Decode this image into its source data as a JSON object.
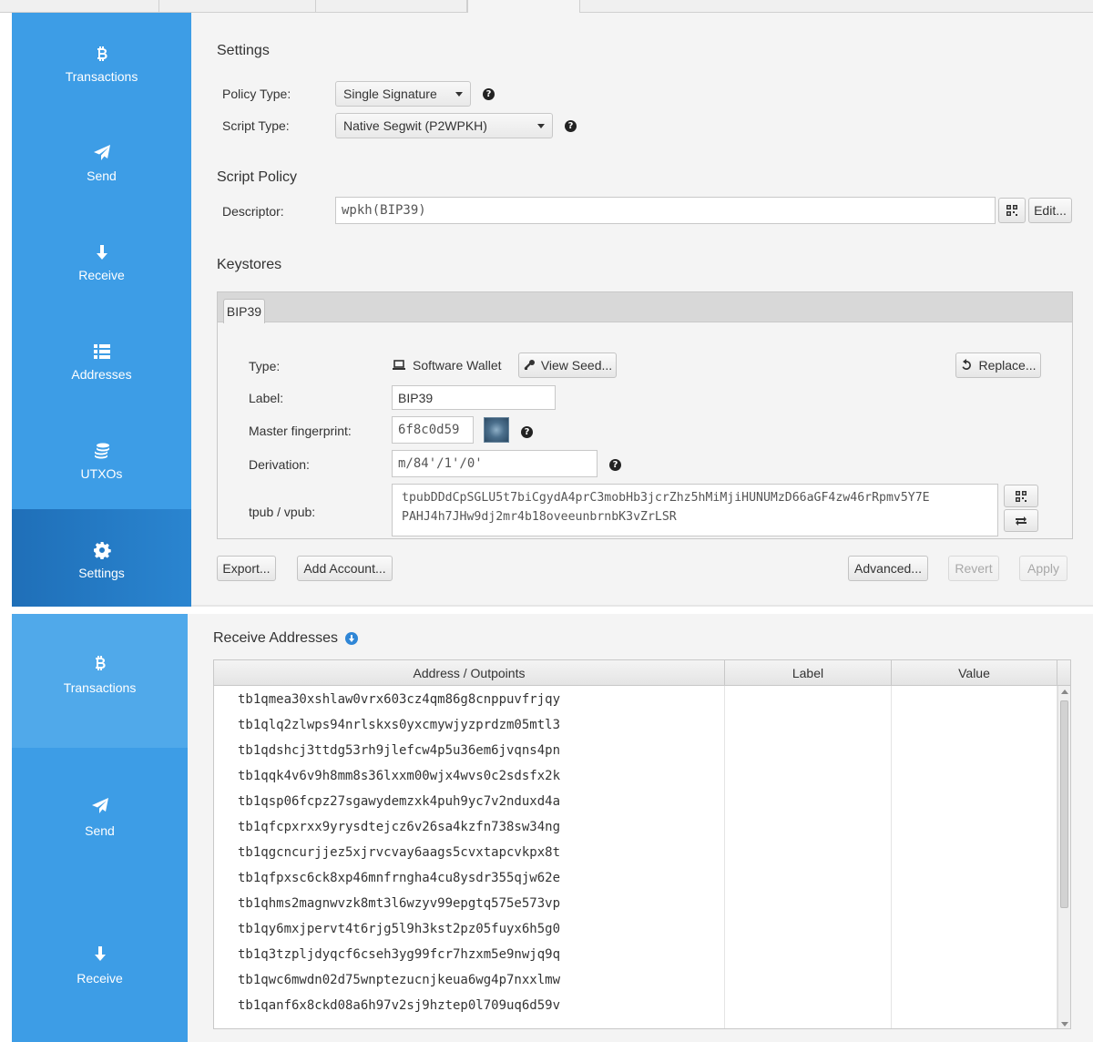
{
  "sidebar": {
    "items": [
      {
        "label": "Transactions",
        "icon": "bitcoin-icon"
      },
      {
        "label": "Send",
        "icon": "send-icon"
      },
      {
        "label": "Receive",
        "icon": "arrow-down-icon"
      },
      {
        "label": "Addresses",
        "icon": "list-icon"
      },
      {
        "label": "UTXOs",
        "icon": "coins-icon"
      },
      {
        "label": "Settings",
        "icon": "gear-icon"
      }
    ],
    "selected": "Settings",
    "color": "#3d9de6"
  },
  "settings": {
    "title": "Settings",
    "policy_type_label": "Policy Type:",
    "policy_type_value": "Single Signature",
    "script_type_label": "Script Type:",
    "script_type_value": "Native Segwit (P2WPKH)"
  },
  "script_policy": {
    "title": "Script Policy",
    "descriptor_label": "Descriptor:",
    "descriptor_value": "wpkh(BIP39)",
    "edit_label": "Edit..."
  },
  "keystores": {
    "title": "Keystores",
    "tab_label": "BIP39",
    "type_label": "Type:",
    "type_value": "Software Wallet",
    "view_seed_label": "View Seed...",
    "replace_label": "Replace...",
    "label_label": "Label:",
    "label_value": "BIP39",
    "fingerprint_label": "Master fingerprint:",
    "fingerprint_value": "6f8c0d59",
    "derivation_label": "Derivation:",
    "derivation_value": "m/84'/1'/0'",
    "xpub_label": "tpub / vpub:",
    "xpub_line1": "tpubDDdCpSGLU5t7biCgydA4prC3mobHb3jcrZhz5hMiMjiHUNUMzD66aGF4zw46rRpmv5Y7E",
    "xpub_line2": "PAHJ4h7JHw9dj2mr4b18oveeunbrnbK3vZrLSR"
  },
  "actions": {
    "export": "Export...",
    "add_account": "Add Account...",
    "advanced": "Advanced...",
    "revert": "Revert",
    "apply": "Apply"
  },
  "sidebar2": {
    "items": [
      {
        "label": "Transactions",
        "icon": "bitcoin-icon"
      },
      {
        "label": "Send",
        "icon": "send-icon"
      },
      {
        "label": "Receive",
        "icon": "arrow-down-icon"
      }
    ]
  },
  "receive": {
    "title": "Receive Addresses",
    "columns": [
      "Address / Outpoints",
      "Label",
      "Value"
    ],
    "addresses": [
      "tb1qmea30xshlaw0vrx603cz4qm86g8cnppuvfrjqy",
      "tb1qlq2zlwps94nrlskxs0yxcmywjyzprdzm05mtl3",
      "tb1qdshcj3ttdg53rh9jlefcw4p5u36em6jvqns4pn",
      "tb1qqk4v6v9h8mm8s36lxxm00wjx4wvs0c2sdsfx2k",
      "tb1qsp06fcpz27sgawydemzxk4puh9yc7v2nduxd4a",
      "tb1qfcpxrxx9yrysdtejcz6v26sa4kzfn738sw34ng",
      "tb1qgcncurjjez5xjrvcvay6aags5cvxtapcvkpx8t",
      "tb1qfpxsc6ck8xp46mnfrngha4cu8ysdr355qjw62e",
      "tb1qhms2magnwvzk8mt3l6wzyv99epgtq575e573vp",
      "tb1qy6mxjpervt4t6rjg5l9h3kst2pz05fuyx6h5g0",
      "tb1q3tzpljdyqcf6cseh3yg99fcr7hzxm5e9nwjq9q",
      "tb1qwc6mwdn02d75wnptezucnjkeua6wg4p7nxxlmw",
      "tb1qanf6x8ckd08a6h97v2sj9hztep0l709uq6d59v"
    ]
  }
}
